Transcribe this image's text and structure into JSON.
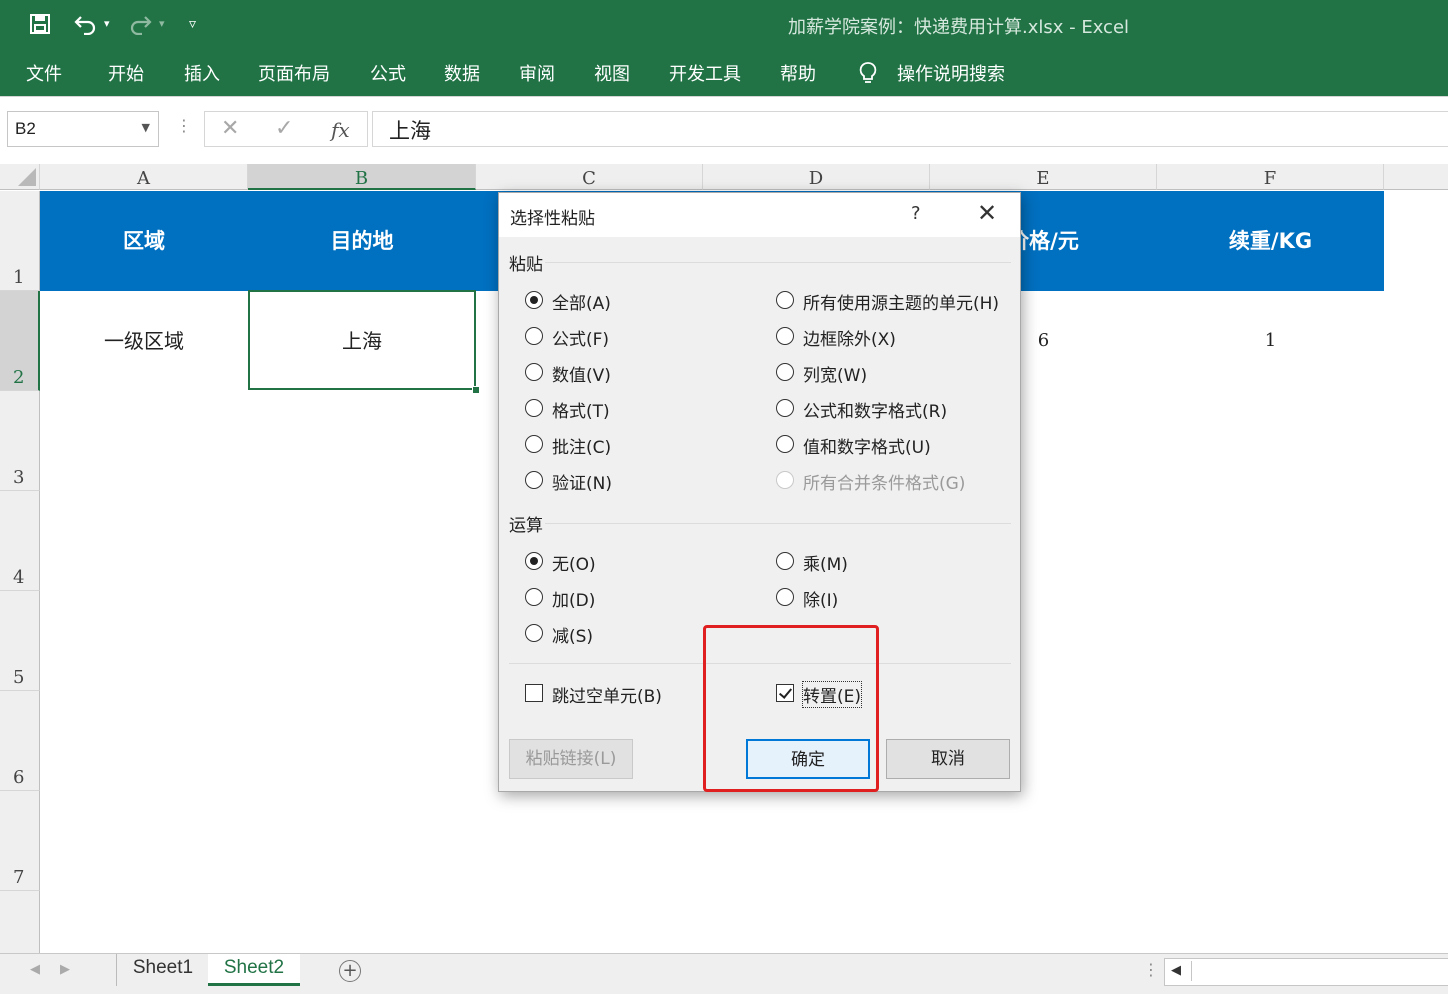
{
  "window": {
    "title": "加薪学院案例：快递费用计算.xlsx  -  Excel"
  },
  "quick_access": {
    "icons": [
      "save-icon",
      "undo-icon",
      "redo-icon",
      "customize-icon"
    ]
  },
  "ribbon": {
    "tabs": [
      "文件",
      "开始",
      "插入",
      "页面布局",
      "公式",
      "数据",
      "审阅",
      "视图",
      "开发工具",
      "帮助",
      "操作说明搜索"
    ]
  },
  "formula_bar": {
    "name_box": "B2",
    "fx_label": "fx",
    "value": "上海"
  },
  "sheet": {
    "columns": [
      "A",
      "B",
      "C",
      "D",
      "E",
      "F"
    ],
    "selected_column": "B",
    "rows": [
      "1",
      "2",
      "3",
      "4",
      "5",
      "6",
      "7"
    ],
    "selected_row": "2",
    "header_row": [
      "区域",
      "目的地",
      "",
      "",
      "价格/元",
      "续重/KG"
    ],
    "data_row": [
      "一级区域",
      "上海",
      "",
      "",
      "6",
      "1"
    ],
    "header_color": "#0070c0"
  },
  "sheet_tabs": {
    "tabs": [
      "Sheet1",
      "Sheet2"
    ],
    "active": "Sheet2"
  },
  "dialog": {
    "title": "选择性粘贴",
    "help": "?",
    "paste_section": "粘贴",
    "paste_left": [
      "全部(A)",
      "公式(F)",
      "数值(V)",
      "格式(T)",
      "批注(C)",
      "验证(N)"
    ],
    "paste_right": [
      "所有使用源主题的单元(H)",
      "边框除外(X)",
      "列宽(W)",
      "公式和数字格式(R)",
      "值和数字格式(U)",
      "所有合并条件格式(G)"
    ],
    "paste_selected": "全部(A)",
    "paste_disabled": "所有合并条件格式(G)",
    "operation_section": "运算",
    "op_left": [
      "无(O)",
      "加(D)",
      "减(S)"
    ],
    "op_right": [
      "乘(M)",
      "除(I)"
    ],
    "op_selected": "无(O)",
    "skip_blanks": {
      "label": "跳过空单元(B)",
      "checked": false
    },
    "transpose": {
      "label": "转置(E)",
      "checked": true
    },
    "buttons": {
      "paste_link": "粘贴链接(L)",
      "ok": "确定",
      "cancel": "取消"
    }
  },
  "annotation": {
    "highlight_color": "#e02020"
  }
}
